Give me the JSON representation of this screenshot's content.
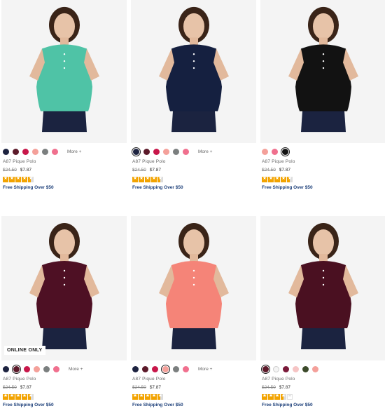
{
  "products": [
    {
      "name": "A87 Pique Polo",
      "price_was": "$24.50",
      "price_now": "$7.87",
      "rating_stars": [
        1,
        1,
        1,
        1,
        0.5
      ],
      "shipping": "Free Shipping Over $50",
      "more_label": "More +",
      "badge": "",
      "shirt_color": "#4fc3a6",
      "swatches": [
        {
          "color": "#1d2340",
          "selected": false
        },
        {
          "color": "#5c1a2a",
          "selected": false
        },
        {
          "color": "#c8174a",
          "selected": false
        },
        {
          "color": "#f4a09a",
          "selected": false
        },
        {
          "color": "#7b7f7f",
          "selected": false
        },
        {
          "color": "#f0708e",
          "selected": false
        }
      ]
    },
    {
      "name": "A87 Pique Polo",
      "price_was": "$24.50",
      "price_now": "$7.87",
      "rating_stars": [
        1,
        1,
        1,
        1,
        0.5
      ],
      "shipping": "Free Shipping Over $50",
      "more_label": "More +",
      "badge": "",
      "shirt_color": "#152040",
      "swatches": [
        {
          "color": "#1d2340",
          "selected": true
        },
        {
          "color": "#5c1a2a",
          "selected": false
        },
        {
          "color": "#c8174a",
          "selected": false
        },
        {
          "color": "#f4a09a",
          "selected": false
        },
        {
          "color": "#7b7f7f",
          "selected": false
        },
        {
          "color": "#f0708e",
          "selected": false
        }
      ]
    },
    {
      "name": "A87 Pique Polo",
      "price_was": "$24.50",
      "price_now": "$7.87",
      "rating_stars": [
        1,
        1,
        1,
        1,
        0.5
      ],
      "shipping": "Free Shipping Over $50",
      "more_label": "",
      "badge": "",
      "shirt_color": "#121212",
      "swatches": [
        {
          "color": "#f4a09a",
          "selected": false
        },
        {
          "color": "#f0708e",
          "selected": false
        },
        {
          "color": "#111111",
          "selected": true
        }
      ]
    },
    {
      "name": "A87 Pique Polo",
      "price_was": "$24.50",
      "price_now": "$7.87",
      "rating_stars": [
        1,
        1,
        1,
        1,
        0.5
      ],
      "shipping": "Free Shipping Over $50",
      "more_label": "More +",
      "badge": "ONLINE ONLY",
      "shirt_color": "#4e1024",
      "swatches": [
        {
          "color": "#1d2340",
          "selected": false
        },
        {
          "color": "#5c1a2a",
          "selected": true
        },
        {
          "color": "#c8174a",
          "selected": false
        },
        {
          "color": "#f4a09a",
          "selected": false
        },
        {
          "color": "#7b7f7f",
          "selected": false
        },
        {
          "color": "#f0708e",
          "selected": false
        }
      ]
    },
    {
      "name": "A87 Pique Polo",
      "price_was": "$24.50",
      "price_now": "$7.87",
      "rating_stars": [
        1,
        1,
        1,
        1,
        0.5
      ],
      "shipping": "Free Shipping Over $50",
      "more_label": "More +",
      "badge": "",
      "shirt_color": "#f58478",
      "swatches": [
        {
          "color": "#1d2340",
          "selected": false
        },
        {
          "color": "#5c1a2a",
          "selected": false
        },
        {
          "color": "#c8174a",
          "selected": false
        },
        {
          "color": "#f4a09a",
          "selected": true
        },
        {
          "color": "#7b7f7f",
          "selected": false
        },
        {
          "color": "#f0708e",
          "selected": false
        }
      ]
    },
    {
      "name": "A87 Pique Polo",
      "price_was": "$24.50",
      "price_now": "$7.87",
      "rating_stars": [
        1,
        1,
        1,
        0.5,
        0
      ],
      "shipping": "Free Shipping Over $50",
      "more_label": "",
      "badge": "",
      "shirt_color": "#4a1021",
      "swatches": [
        {
          "color": "#5c1a2a",
          "selected": true
        },
        {
          "color": "#f4f4f4",
          "selected": false
        },
        {
          "color": "#7a1a3a",
          "selected": false
        },
        {
          "color": "#f6c4c4",
          "selected": false
        },
        {
          "color": "#3c4a2a",
          "selected": false
        },
        {
          "color": "#f4a09a",
          "selected": false
        }
      ]
    }
  ]
}
